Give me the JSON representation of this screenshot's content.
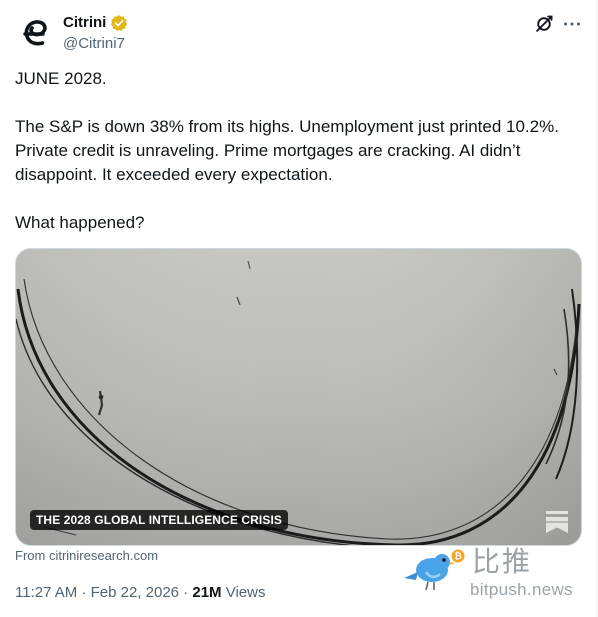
{
  "author": {
    "display_name": "Citrini",
    "handle": "@Citrini7",
    "verified_color": "#e2b719",
    "avatar_icon": "citrini-logo"
  },
  "tweet": {
    "paragraphs": [
      "JUNE 2028.",
      "The S&P is down 38% from its highs. Unemployment just printed 10.2%. Private credit is unraveling. Prime mortgages are cracking. AI didn’t disappoint. It exceeded every expectation.",
      "What happened?"
    ]
  },
  "card": {
    "label": "THE 2028 GLOBAL INTELLIGENCE CRISIS",
    "source": "From citriniresearch.com"
  },
  "meta": {
    "time": "11:27 AM",
    "separator": " · ",
    "date": "Feb 22, 2026",
    "views_count": "21M",
    "views_label": " Views"
  },
  "header_icons": {
    "grok": "grok-icon",
    "more": "more-icon"
  },
  "watermark": {
    "chinese": "比推",
    "url": "bitpush.news"
  }
}
